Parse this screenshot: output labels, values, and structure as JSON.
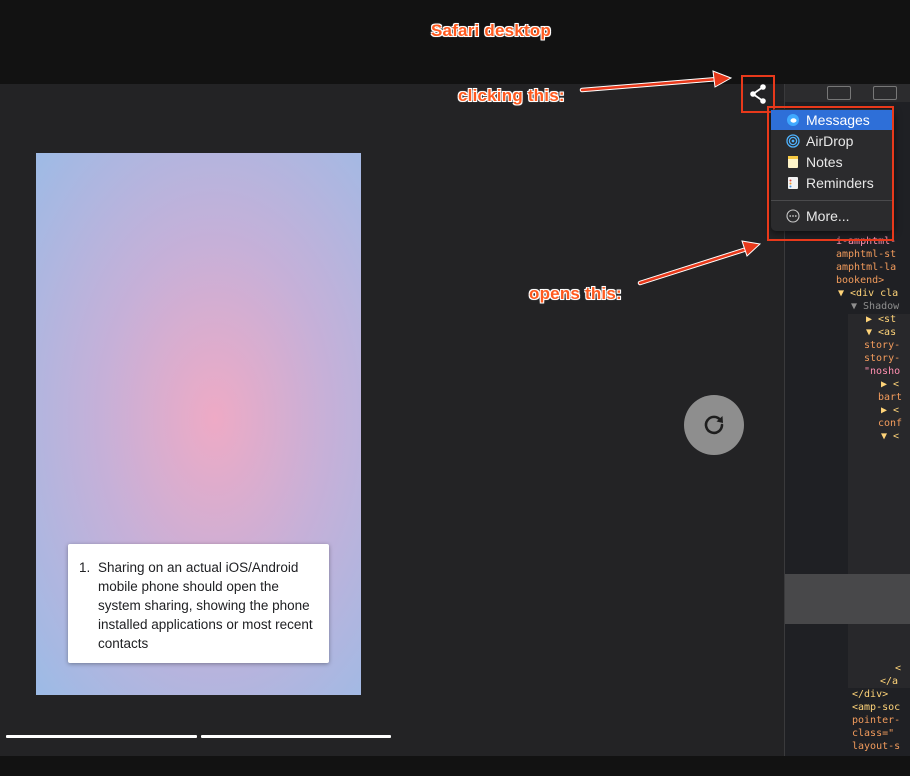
{
  "annotations": {
    "title": "Safari desktop",
    "clicking": "clicking this:",
    "opens": "opens this:"
  },
  "story": {
    "note_number": "1.",
    "note_text": "Sharing on an actual iOS/Android mobile phone should open the system sharing, showing the phone installed applications or most recent contacts"
  },
  "share_menu": {
    "items": [
      {
        "label": "Messages",
        "icon": "messages-icon",
        "selected": true
      },
      {
        "label": "AirDrop",
        "icon": "airdrop-icon"
      },
      {
        "label": "Notes",
        "icon": "notes-icon"
      },
      {
        "label": "Reminders",
        "icon": "reminders-icon"
      },
      {
        "label": "More...",
        "icon": "more-icon"
      }
    ]
  },
  "devtools": {
    "lines": [
      "i-amphtml-",
      "amphtml-st",
      "amphtml-la",
      "bookend>",
      "▼ <div cla",
      "▼ Shadow",
      "▶ <st",
      "▼ <as",
      "story-",
      "story-",
      "\"nosho",
      "▶ <",
      "bart",
      "▶ <",
      "conf",
      "▼ <",
      "<",
      "</a",
      "</div>",
      "<amp-soc",
      "pointer-",
      "class=\"",
      "layout-s"
    ]
  },
  "colors": {
    "annotation": "#ff5a1f",
    "highlight_box": "#e8391b",
    "menu_selected": "#2e6fd8"
  }
}
